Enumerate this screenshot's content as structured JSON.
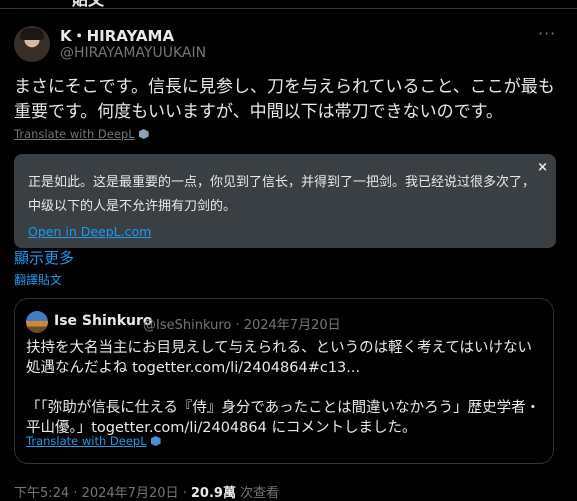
{
  "header": {
    "back_glyph": "←",
    "title": "貼文"
  },
  "author": {
    "name": "K・HIRAYAMA",
    "handle": "@HIRAYAMAYUUKAIN",
    "avatar_icon": "avatar-photo",
    "more_icon": "more-dots-icon",
    "more_glyph": "···"
  },
  "post": {
    "text": "まさにそこです。信長に見参し、刀を与えられていること、ここが最も重要です。何度もいいますが、中間以下は帯刀できないのです。",
    "translate_link": "Translate with DeepL",
    "translation": {
      "close_glyph": "×",
      "text": "正是如此。这是最重要的一点，你见到了信长，并得到了一把剑。我已经说过很多次了，中级以下的人是不允许拥有刀剑的。",
      "open_link": "Open in DeepL.com"
    },
    "show_more": "顯示更多",
    "translate_post": "翻譯貼文"
  },
  "quote": {
    "name": "Ise Shinkuro",
    "meta": "@IseShinkuro · 2024年7月20日",
    "line1": "扶持を大名当主にお目見えして与えられる、というのは軽く考えてはいけない処遇なんだよね togetter.com/li/2404864#c13...",
    "line2": "「「弥助が信長に仕える『侍』身分であったことは間違いなかろう」歴史学者・平山優。」togetter.com/li/2404864 にコメントしました。",
    "translate_link": "Translate with DeepL"
  },
  "footer": {
    "time": "下午5:24 · 2024年7月20日 · ",
    "views": "20.9萬",
    "views_label": " 次查看"
  },
  "colors": {
    "background": "#000000",
    "text": "#e7e9ea",
    "secondary": "#71767b",
    "accent": "#1d9bf0",
    "translation_box": "#3a3f44"
  }
}
